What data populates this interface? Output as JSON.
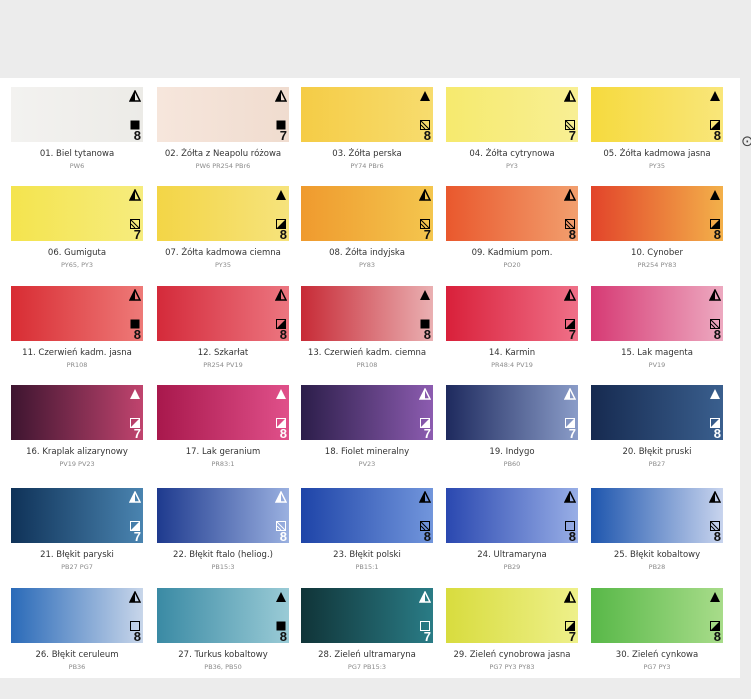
{
  "swatches": [
    {
      "name": "01. Biel tytanowa",
      "code": "PW6",
      "number": "8",
      "triangle": "partial",
      "square": "full",
      "colors": [
        "#f3f2f0",
        "#ecebe7"
      ]
    },
    {
      "name": "02. Żółta z Neapolu różowa",
      "code": "PW6 PR254 PBr6",
      "number": "7",
      "triangle": "partial",
      "square": "full",
      "colors": [
        "#f6e6dc",
        "#f0dccf"
      ]
    },
    {
      "name": "03. Żółta perska",
      "code": "PY74 PBr6",
      "number": "8",
      "triangle": "full",
      "square": "hatched",
      "colors": [
        "#f5cc46",
        "#f7dc6e"
      ]
    },
    {
      "name": "04. Żółta cytrynowa",
      "code": "PY3",
      "number": "7",
      "triangle": "partial",
      "square": "hatched",
      "colors": [
        "#f6ea6e",
        "#f8ef94"
      ]
    },
    {
      "name": "05. Żółta kadmowa jasna",
      "code": "PY35",
      "number": "8",
      "triangle": "full",
      "square": "half",
      "colors": [
        "#f6da3e",
        "#f9e67a"
      ]
    },
    {
      "name": "06. Gumiguta",
      "code": "PY65, PY3",
      "number": "7",
      "triangle": "partial",
      "square": "hatched",
      "colors": [
        "#f4e44e",
        "#f6ec7e"
      ]
    },
    {
      "name": "07. Żółta kadmowa ciemna",
      "code": "PY35",
      "number": "8",
      "triangle": "full",
      "square": "half",
      "colors": [
        "#f3d546",
        "#f6e37c"
      ]
    },
    {
      "name": "08. Żółta indyjska",
      "code": "PY83",
      "number": "7",
      "triangle": "partial",
      "square": "hatched",
      "colors": [
        "#ef9a2e",
        "#f4c64e"
      ]
    },
    {
      "name": "09. Kadmium pom.",
      "code": "PO20",
      "number": "8",
      "triangle": "partial",
      "square": "hatched",
      "colors": [
        "#e9582d",
        "#f29f6e"
      ]
    },
    {
      "name": "10. Cynober",
      "code": "PR254 PY83",
      "number": "8",
      "triangle": "full",
      "square": "half",
      "colors": [
        "#e2442a",
        "#f3b04a"
      ]
    },
    {
      "name": "11. Czerwień kadm. jasna",
      "code": "PR108",
      "number": "8",
      "triangle": "partial",
      "square": "full",
      "colors": [
        "#d82c33",
        "#ee7a78"
      ]
    },
    {
      "name": "12. Szkarłat",
      "code": "PR254 PV19",
      "number": "8",
      "triangle": "partial",
      "square": "half",
      "colors": [
        "#d42a3a",
        "#ec7680"
      ]
    },
    {
      "name": "13. Czerwień kadm. ciemna",
      "code": "PR108",
      "number": "8",
      "triangle": "full",
      "square": "full",
      "colors": [
        "#c72a36",
        "#eab0b2"
      ]
    },
    {
      "name": "14. Karmin",
      "code": "PR48:4 PV19",
      "number": "7",
      "triangle": "partial",
      "square": "half",
      "colors": [
        "#d9203a",
        "#ef7088"
      ]
    },
    {
      "name": "15. Lak magenta",
      "code": "PV19",
      "number": "8",
      "triangle": "partial",
      "square": "hatched",
      "colors": [
        "#d63a74",
        "#eda9c0"
      ]
    },
    {
      "name": "16. Kraplak alizarynowy",
      "code": "PV19 PV23",
      "number": "7",
      "triangle": "full",
      "square": "half",
      "colors": [
        "#3e1530",
        "#c0446e"
      ]
    },
    {
      "name": "17. Lak geranium",
      "code": "PR83:1",
      "number": "8",
      "triangle": "full",
      "square": "half",
      "colors": [
        "#a8184c",
        "#e0508a"
      ]
    },
    {
      "name": "18. Fiolet mineralny",
      "code": "PV23",
      "number": "7",
      "triangle": "partial",
      "square": "half",
      "colors": [
        "#2c1e4a",
        "#8c5cb0"
      ]
    },
    {
      "name": "19. Indygo",
      "code": "PB60",
      "number": "7",
      "triangle": "partial",
      "square": "half",
      "colors": [
        "#1e2a5e",
        "#8a9cc8"
      ]
    },
    {
      "name": "20. Błękit pruski",
      "code": "PB27",
      "number": "8",
      "triangle": "full",
      "square": "half",
      "colors": [
        "#162a50",
        "#3a5f8e"
      ]
    },
    {
      "name": "21. Błękit paryski",
      "code": "PB27 PG7",
      "number": "7",
      "triangle": "partial",
      "square": "half",
      "colors": [
        "#0f3258",
        "#4a84b0"
      ]
    },
    {
      "name": "22. Błękit ftalo (heliog.)",
      "code": "PB15:3",
      "number": "8",
      "triangle": "partial",
      "square": "hatched",
      "colors": [
        "#1e3a8e",
        "#9ab0e0"
      ]
    },
    {
      "name": "23. Błękit polski",
      "code": "PB15:1",
      "number": "8",
      "triangle": "partial",
      "square": "hatched",
      "colors": [
        "#1e44a8",
        "#7296dc"
      ]
    },
    {
      "name": "24. Ultramaryna",
      "code": "PB29",
      "number": "8",
      "triangle": "partial",
      "square": "empty",
      "colors": [
        "#2a48b0",
        "#98aee6"
      ]
    },
    {
      "name": "25. Błękit kobaltowy",
      "code": "PB28",
      "number": "8",
      "triangle": "partial",
      "square": "hatched",
      "colors": [
        "#1e56ae",
        "#c8d4ee"
      ]
    },
    {
      "name": "26. Błękit ceruleum",
      "code": "PB36",
      "number": "8",
      "triangle": "partial",
      "square": "empty",
      "colors": [
        "#2a6ab8",
        "#c8d6ea"
      ]
    },
    {
      "name": "27. Turkus kobaltowy",
      "code": "PB36, PB50",
      "number": "8",
      "triangle": "full",
      "square": "full",
      "colors": [
        "#3a8aa4",
        "#9acbd6"
      ]
    },
    {
      "name": "28. Zieleń ultramaryna",
      "code": "PG7 PB15:3",
      "number": "7",
      "triangle": "partial",
      "square": "empty",
      "colors": [
        "#103438",
        "#2a7c86"
      ]
    },
    {
      "name": "29. Zieleń cynobrowa jasna",
      "code": "PG7 PY3 PY83",
      "number": "7",
      "triangle": "partial",
      "square": "half",
      "colors": [
        "#d8dc3e",
        "#eef08a"
      ]
    },
    {
      "name": "30. Zieleń cynkowa",
      "code": "PG7 PY3",
      "number": "8",
      "triangle": "full",
      "square": "half",
      "colors": [
        "#58b848",
        "#a8dc8a"
      ]
    }
  ]
}
